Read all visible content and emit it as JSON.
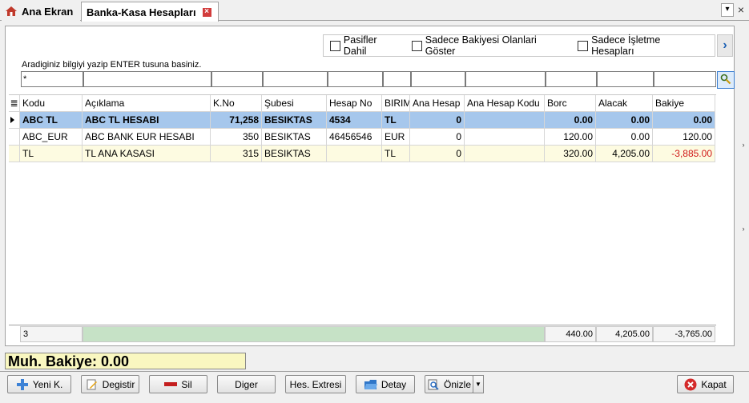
{
  "tabs": {
    "home_label": "Ana Ekran",
    "active_label": "Banka-Kasa Hesapları"
  },
  "filters": {
    "pasifler": "Pasifler Dahil",
    "bakiyesi": "Sadece Bakiyesi Olanlari Göster",
    "isletme": "Sadece İşletme Hesapları"
  },
  "search": {
    "hint": "Aradiginiz bilgiyi yazip ENTER tusuna basiniz.",
    "value": "*"
  },
  "grid": {
    "headers": [
      "Kodu",
      "Açıklama",
      "K.No",
      "Şubesi",
      "Hesap No",
      "BIRIM",
      "Ana Hesap",
      "Ana Hesap Kodu",
      "Borc",
      "Alacak",
      "Bakiye"
    ],
    "rows": [
      [
        "ABC TL",
        "ABC TL HESABI",
        "71,258",
        "BESIKTAS",
        "4534",
        "TL",
        "0",
        "",
        "0.00",
        "0.00",
        "0.00"
      ],
      [
        "ABC_EUR",
        "ABC BANK EUR HESABI",
        "350",
        "BESIKTAS",
        "46456546",
        "EUR",
        "0",
        "",
        "120.00",
        "0.00",
        "120.00"
      ],
      [
        "TL",
        "TL ANA KASASI",
        "315",
        "BESIKTAS",
        "",
        "TL",
        "0",
        "",
        "320.00",
        "4,205.00",
        "-3,885.00"
      ]
    ],
    "footer": {
      "count": "3",
      "borc": "440.00",
      "alacak": "4,205.00",
      "bakiye": "-3,765.00"
    }
  },
  "balance": "Muh. Bakiye: 0.00",
  "buttons": {
    "yeni": "Yeni K.",
    "degistir": "Degistir",
    "sil": "Sil",
    "diger": "Diger",
    "hes_extresi": "Hes. Extresi",
    "detay": "Detay",
    "onizle": "Önizle",
    "kapat": "Kapat"
  },
  "colors": {
    "selected_row": "#a6c7ec",
    "alt_row": "#fdfbe1",
    "negative": "#d01818",
    "balance_bg": "#f9f7c0"
  }
}
